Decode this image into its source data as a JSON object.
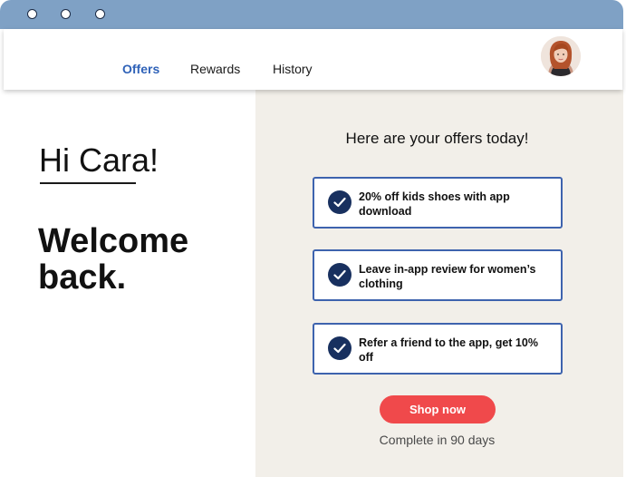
{
  "window": {
    "controls": [
      "window-dot",
      "window-dot",
      "window-dot"
    ],
    "titlebar_color": "#7fa1c5"
  },
  "nav": {
    "tabs": [
      {
        "label": "Offers",
        "active": true
      },
      {
        "label": "Rewards",
        "active": false
      },
      {
        "label": "History",
        "active": false
      }
    ],
    "active_color": "#2f62b8",
    "avatar_icon": "user-avatar"
  },
  "welcome": {
    "greeting": "Hi Cara!",
    "message": "Welcome back."
  },
  "offers": {
    "heading": "Here are your offers today!",
    "items": [
      {
        "text": "20% off kids shoes with app download",
        "checked": true
      },
      {
        "text": "Leave in-app review for women’s clothing",
        "checked": true
      },
      {
        "text": "Refer a friend to the app, get 10% off",
        "checked": true
      }
    ],
    "card_border_color": "#3e63ae",
    "check_color": "#18305f",
    "cta_label": "Shop now",
    "cta_color": "#f0494b",
    "deadline": "Complete in 90 days",
    "panel_color": "#f2efe9"
  }
}
